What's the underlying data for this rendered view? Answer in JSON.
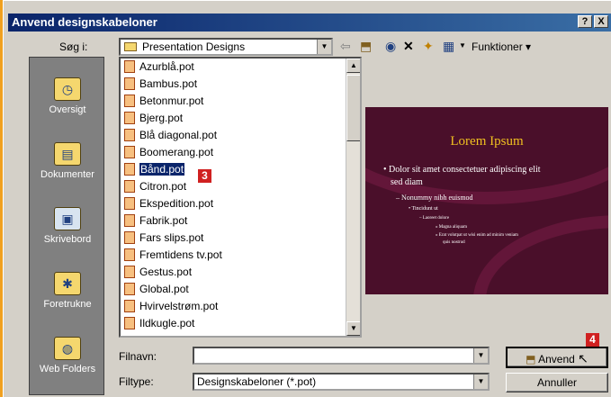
{
  "window": {
    "title": "Anvend designskabeloner",
    "help_label": "?",
    "close_label": "X"
  },
  "lookin": {
    "label": "Søg i:",
    "value": "Presentation Designs"
  },
  "toolbar": {
    "back_icon": "back-arrow-icon",
    "up_icon": "up-folder-icon",
    "search_icon": "search-web-icon",
    "delete_icon": "delete-icon",
    "newfolder_icon": "new-folder-icon",
    "views_icon": "views-icon",
    "tools_label": "Funktioner"
  },
  "places": [
    {
      "label": "Oversigt",
      "icon": "history-icon"
    },
    {
      "label": "Dokumenter",
      "icon": "my-documents-icon"
    },
    {
      "label": "Skrivebord",
      "icon": "desktop-icon"
    },
    {
      "label": "Foretrukne",
      "icon": "favorites-icon"
    },
    {
      "label": "Web Folders",
      "icon": "web-folders-icon"
    }
  ],
  "files": [
    "Azurblå.pot",
    "Bambus.pot",
    "Betonmur.pot",
    "Bjerg.pot",
    "Blå diagonal.pot",
    "Boomerang.pot",
    "Bånd.pot",
    "Citron.pot",
    "Ekspedition.pot",
    "Fabrik.pot",
    "Fars slips.pot",
    "Fremtidens tv.pot",
    "Gestus.pot",
    "Global.pot",
    "Hvirvelstrøm.pot",
    "Ildkugle.pot"
  ],
  "selected_index": 6,
  "preview": {
    "title": "Lorem Ipsum",
    "l1": "• Dolor sit amet consectetuer adipiscing elit",
    "l1b": "sed diam",
    "l2": "– Nonummy nibh euismod",
    "l3": "• Tincidunt ut",
    "l4": "– Laoreet dolore",
    "l5": "» Magna aliquam",
    "l6": "» Erat volutpat ut wisi enim ad minim veniam",
    "l6b": "quis nostrud"
  },
  "filename": {
    "label": "Filnavn:",
    "value": ""
  },
  "filetype": {
    "label": "Filtype:",
    "value": "Designskabeloner (*.pot)"
  },
  "buttons": {
    "apply": "Anvend",
    "cancel": "Annuller"
  },
  "badges": {
    "b3": "3",
    "b4": "4"
  },
  "colors": {
    "desktop_bg": "#f0a020",
    "titlebar": "#0a246a",
    "selection": "#0a246a",
    "badge": "#d02020",
    "preview_bg": "#4a0f2a",
    "preview_title": "#f0c020"
  }
}
